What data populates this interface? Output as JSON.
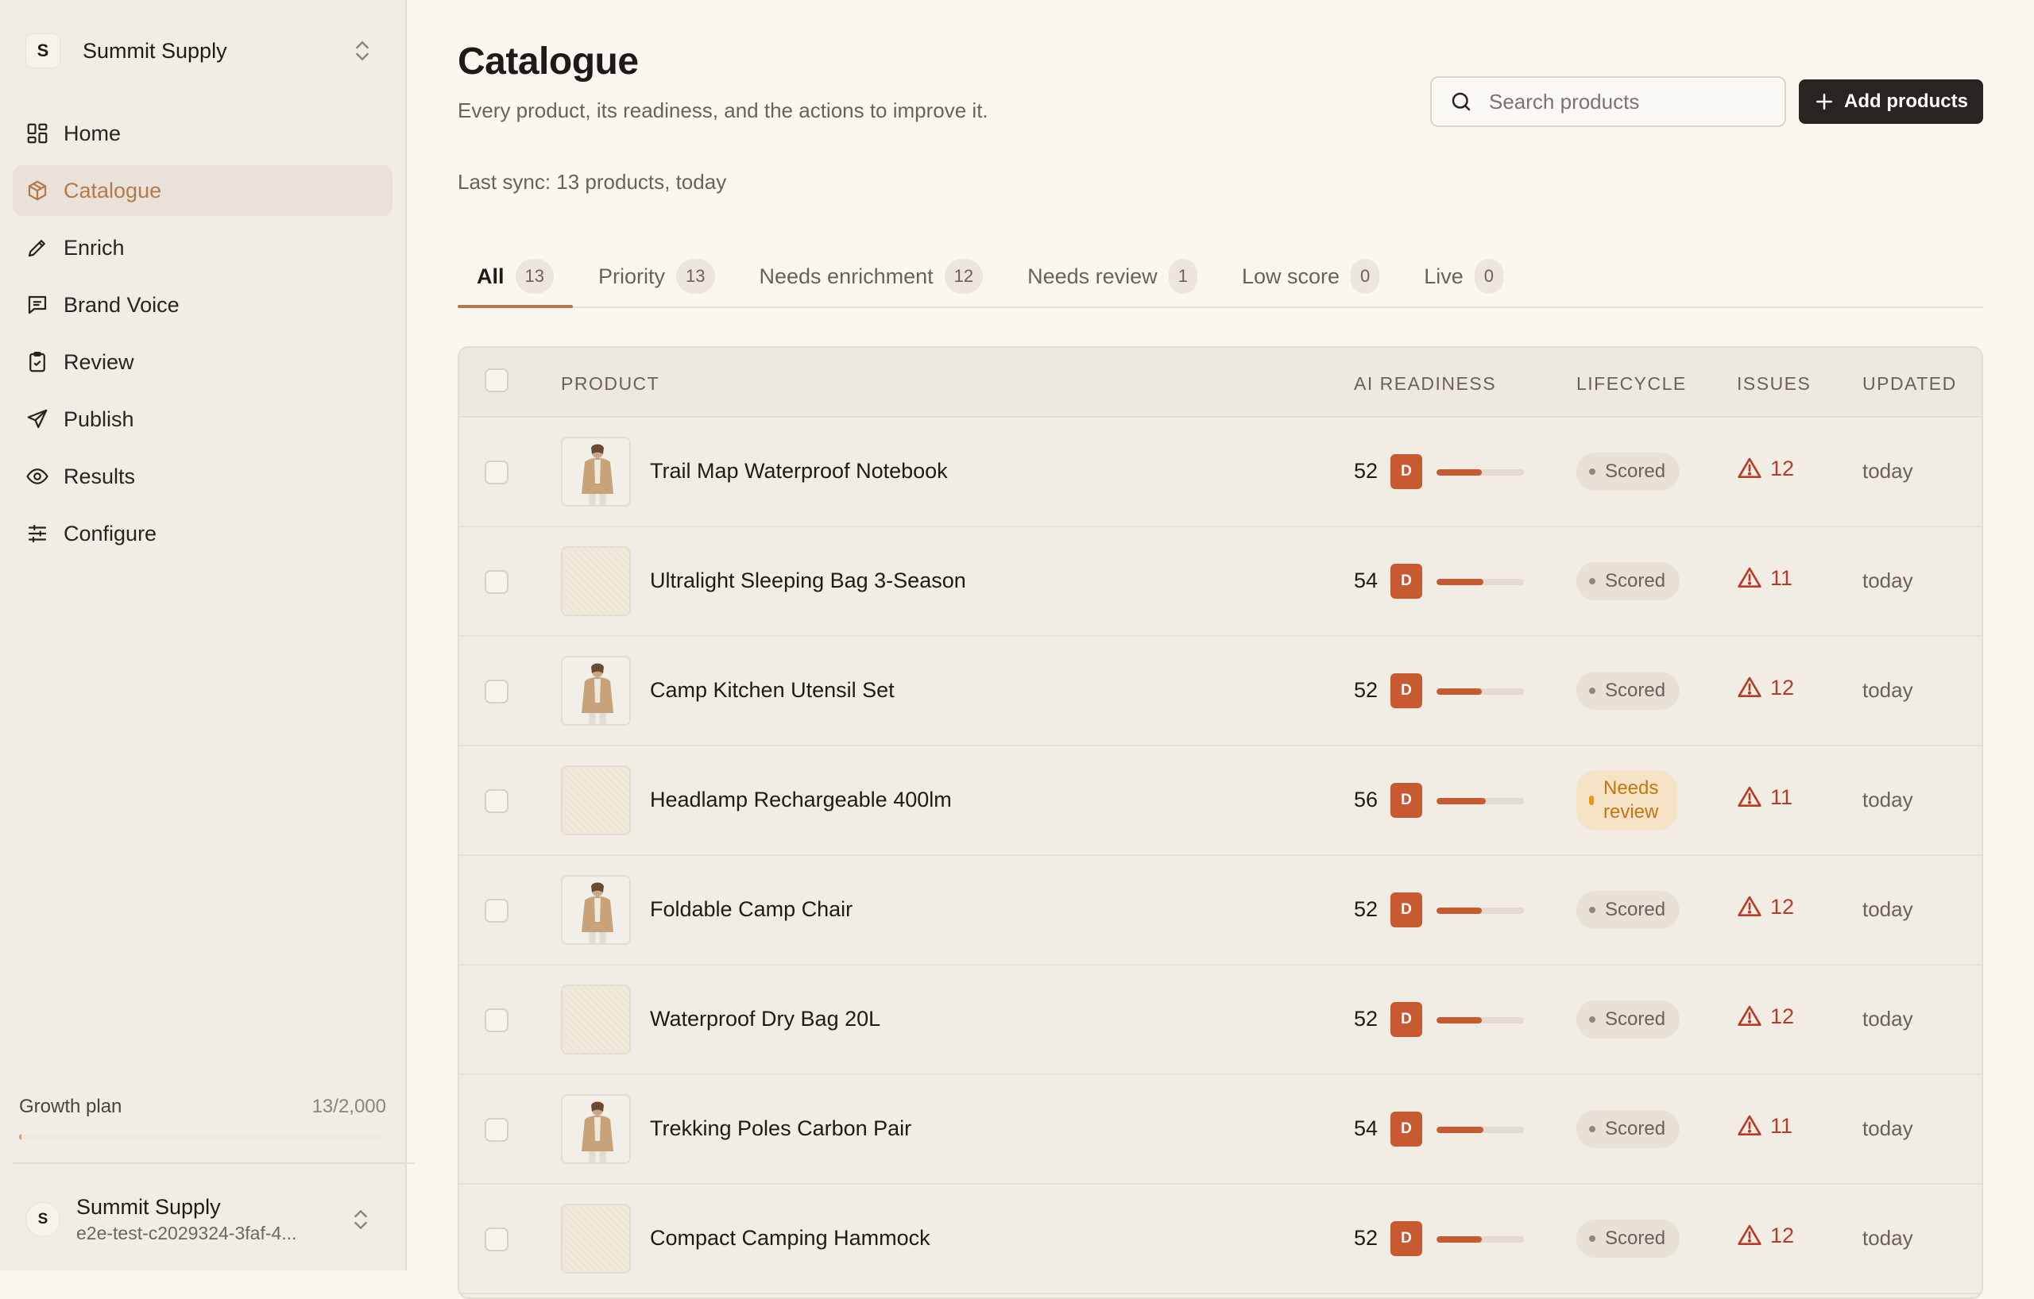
{
  "workspace": {
    "initial": "S",
    "name": "Summit Supply"
  },
  "nav": [
    {
      "label": "Home",
      "icon": "home-icon",
      "active": false
    },
    {
      "label": "Catalogue",
      "icon": "package-icon",
      "active": true
    },
    {
      "label": "Enrich",
      "icon": "pencil-icon",
      "active": false
    },
    {
      "label": "Brand Voice",
      "icon": "message-icon",
      "active": false
    },
    {
      "label": "Review",
      "icon": "clipboard-check-icon",
      "active": false
    },
    {
      "label": "Publish",
      "icon": "send-icon",
      "active": false
    },
    {
      "label": "Results",
      "icon": "eye-icon",
      "active": false
    },
    {
      "label": "Configure",
      "icon": "sliders-icon",
      "active": false
    }
  ],
  "plan": {
    "label": "Growth plan",
    "usage": "13/2,000",
    "fraction": 0.0065
  },
  "account": {
    "initial": "S",
    "name": "Summit Supply",
    "email": "e2e-test-c2029324-3faf-4..."
  },
  "header": {
    "title": "Catalogue",
    "subtitle": "Every product, its readiness, and the actions to improve it.",
    "search_placeholder": "Search products",
    "add_label": "Add products",
    "last_sync": "Last sync: 13 products, today"
  },
  "tabs": [
    {
      "label": "All",
      "count": "13",
      "active": true
    },
    {
      "label": "Priority",
      "count": "13",
      "active": false
    },
    {
      "label": "Needs enrichment",
      "count": "12",
      "active": false
    },
    {
      "label": "Needs review",
      "count": "1",
      "active": false
    },
    {
      "label": "Low score",
      "count": "0",
      "active": false
    },
    {
      "label": "Live",
      "count": "0",
      "active": false
    }
  ],
  "table": {
    "columns": {
      "product": "PRODUCT",
      "readiness": "AI READINESS",
      "lifecycle": "LIFECYCLE",
      "issues": "ISSUES",
      "updated": "UPDATED"
    },
    "rows": [
      {
        "name": "Trail Map Waterproof Notebook",
        "score": "52",
        "grade": "D",
        "progress": 0.52,
        "lifecycle": "Scored",
        "issues": "12",
        "updated": "today",
        "thumb": "jacket"
      },
      {
        "name": "Ultralight Sleeping Bag 3-Season",
        "score": "54",
        "grade": "D",
        "progress": 0.54,
        "lifecycle": "Scored",
        "issues": "11",
        "updated": "today",
        "thumb": "pattern"
      },
      {
        "name": "Camp Kitchen Utensil Set",
        "score": "52",
        "grade": "D",
        "progress": 0.52,
        "lifecycle": "Scored",
        "issues": "12",
        "updated": "today",
        "thumb": "jacket"
      },
      {
        "name": "Headlamp Rechargeable 400lm",
        "score": "56",
        "grade": "D",
        "progress": 0.56,
        "lifecycle": "Needs\nreview",
        "issues": "11",
        "updated": "today",
        "thumb": "pattern"
      },
      {
        "name": "Foldable Camp Chair",
        "score": "52",
        "grade": "D",
        "progress": 0.52,
        "lifecycle": "Scored",
        "issues": "12",
        "updated": "today",
        "thumb": "jacket"
      },
      {
        "name": "Waterproof Dry Bag 20L",
        "score": "52",
        "grade": "D",
        "progress": 0.52,
        "lifecycle": "Scored",
        "issues": "12",
        "updated": "today",
        "thumb": "pattern"
      },
      {
        "name": "Trekking Poles Carbon Pair",
        "score": "54",
        "grade": "D",
        "progress": 0.54,
        "lifecycle": "Scored",
        "issues": "11",
        "updated": "today",
        "thumb": "jacket"
      },
      {
        "name": "Compact Camping Hammock",
        "score": "52",
        "grade": "D",
        "progress": 0.52,
        "lifecycle": "Scored",
        "issues": "12",
        "updated": "today",
        "thumb": "pattern"
      }
    ]
  },
  "colors": {
    "accent": "#b27a4f",
    "grade_d": "#c85a32",
    "issues": "#b83b27",
    "needs_review_bg": "#f6e2c5",
    "needs_review_text": "#c47612",
    "primary_button": "#2a2420"
  }
}
